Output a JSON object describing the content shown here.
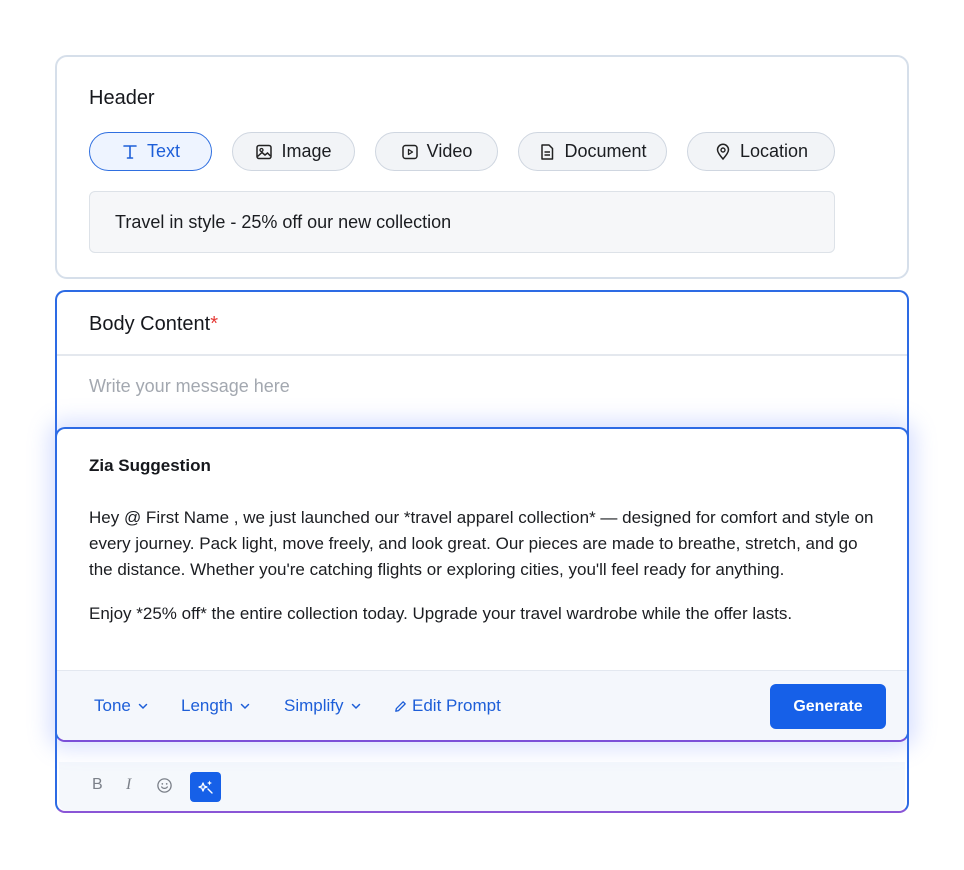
{
  "header_section": {
    "title": "Header",
    "tabs": [
      {
        "label": "Text",
        "icon": "text-icon",
        "active": true
      },
      {
        "label": "Image",
        "icon": "image-icon",
        "active": false
      },
      {
        "label": "Video",
        "icon": "video-icon",
        "active": false
      },
      {
        "label": "Document",
        "icon": "document-icon",
        "active": false
      },
      {
        "label": "Location",
        "icon": "location-icon",
        "active": false
      }
    ],
    "input_value": "Travel in style - 25% off our new collection"
  },
  "body_section": {
    "title": "Body Content",
    "required_marker": "*",
    "placeholder": "Write your message here",
    "format_tools": [
      "B",
      "I"
    ]
  },
  "zia_suggestion": {
    "title": "Zia Suggestion",
    "paragraph_1": "Hey @ First Name , we just launched our *travel apparel collection* — designed for comfort and style on every journey. Pack light, move freely, and look great. Our pieces are made to breathe, stretch, and go the distance. Whether you're catching flights or exploring cities, you'll feel ready for anything.",
    "paragraph_2": "Enjoy *25% off* the entire collection today. Upgrade your travel wardrobe while the offer lasts.",
    "toolbar": {
      "tone": "Tone",
      "length": "Length",
      "simplify": "Simplify",
      "edit_prompt": "Edit Prompt",
      "generate": "Generate"
    }
  },
  "colors": {
    "accent": "#1660e8",
    "active_border": "#2d6be4",
    "required": "#e53935"
  }
}
